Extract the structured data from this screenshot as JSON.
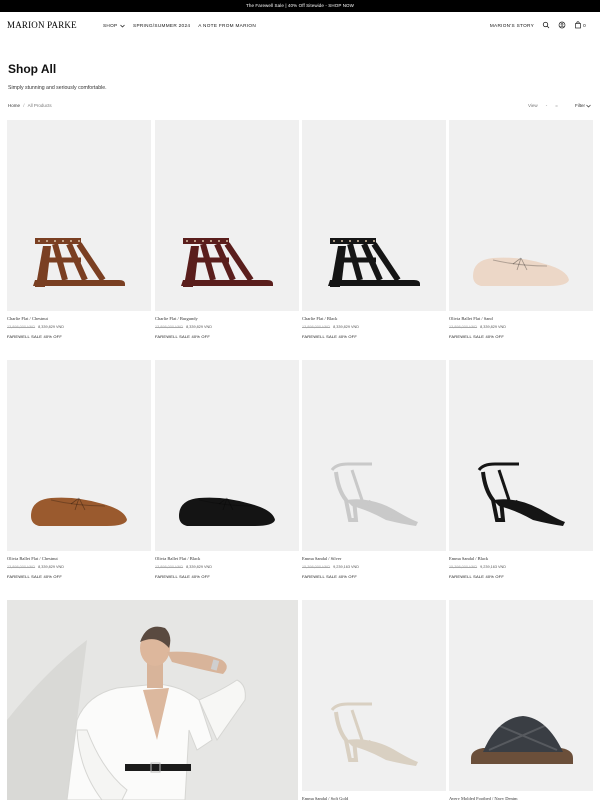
{
  "announcement": "The Farewell Sale | 40% Off Sitewide - SHOP NOW",
  "header": {
    "logo": "MARION PARKE",
    "nav": [
      {
        "label": "SHOP"
      },
      {
        "label": "SPRING/SUMMER 2024"
      },
      {
        "label": "A NOTE FROM MARION"
      }
    ],
    "story_link": "MARION'S STORY",
    "cart_count": "0"
  },
  "page": {
    "title": "Shop All",
    "subtitle": "Simply stunning and seriously comfortable.",
    "breadcrumb": {
      "home": "Home",
      "separator": "/",
      "current": "All Products"
    },
    "view_label": "View",
    "view_options": [
      "-",
      "="
    ],
    "filter_label": "Filter"
  },
  "colors": {
    "background": "#ffffff",
    "tile": "#f0f0f0",
    "text": "#111111"
  },
  "products": [
    {
      "name": "Charlie Flat / Chestnut",
      "old_price": "13,898,000 VND",
      "price": "8,339,829 VND",
      "badge": "FAREWELL SALE 40% OFF",
      "shoe": "strappy-sandal",
      "color": "#7a3f22"
    },
    {
      "name": "Charlie Flat / Burgundy",
      "old_price": "13,898,000 VND",
      "price": "8,339,829 VND",
      "badge": "FAREWELL SALE 40% OFF",
      "shoe": "strappy-sandal",
      "color": "#5a1e1c"
    },
    {
      "name": "Charlie Flat / Black",
      "old_price": "13,898,000 VND",
      "price": "8,339,829 VND",
      "badge": "FAREWELL SALE 40% OFF",
      "shoe": "strappy-sandal",
      "color": "#151515"
    },
    {
      "name": "Olivia Ballet Flat / Sand",
      "old_price": "13,898,000 VND",
      "price": "8,339,829 VND",
      "badge": "FAREWELL SALE 40% OFF",
      "shoe": "ballet-flat",
      "color": "#ecd7c7"
    },
    {
      "name": "Olivia Ballet Flat / Chestnut",
      "old_price": "13,898,000 VND",
      "price": "8,339,829 VND",
      "badge": "FAREWELL SALE 40% OFF",
      "shoe": "ballet-flat",
      "color": "#9a5a2e"
    },
    {
      "name": "Olivia Ballet Flat / Black",
      "old_price": "13,898,000 VND",
      "price": "8,339,829 VND",
      "badge": "FAREWELL SALE 40% OFF",
      "shoe": "ballet-flat",
      "color": "#141414"
    },
    {
      "name": "Emma Sandal / Silver",
      "old_price": "15,398,000 VND",
      "price": "9,239,163 VND",
      "badge": "FAREWELL SALE 40% OFF",
      "shoe": "heel-sandal",
      "color": "#c9c9c9"
    },
    {
      "name": "Emma Sandal / Black",
      "old_price": "15,398,000 VND",
      "price": "9,239,163 VND",
      "badge": "FAREWELL SALE 40% OFF",
      "shoe": "heel-sandal",
      "color": "#151515"
    },
    {
      "name": "Emma Sandal / Soft Gold",
      "shoe": "heel-sandal",
      "color": "#d9d0c2"
    },
    {
      "name": "Avery Molded Footbed / Navy Denim",
      "shoe": "slide",
      "color": "#3a3e44"
    }
  ]
}
